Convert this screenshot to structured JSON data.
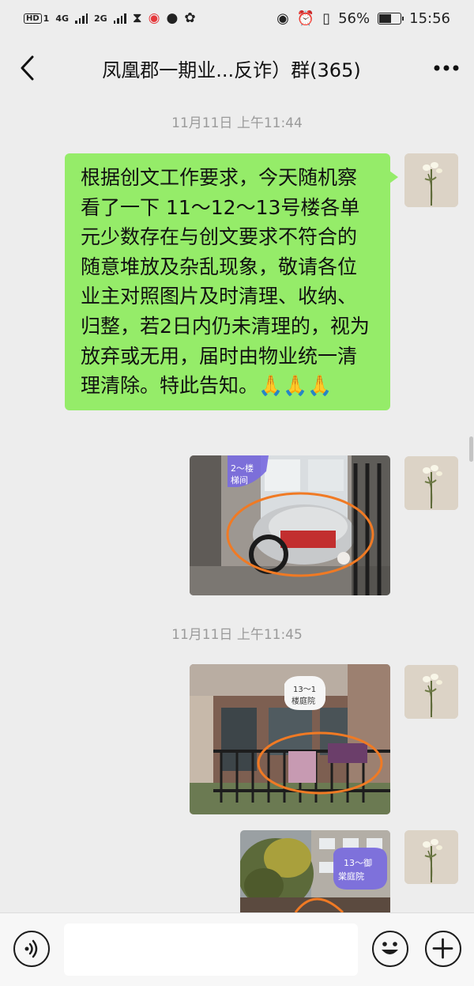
{
  "status_bar": {
    "left_hd": "HD",
    "left_sim": "1",
    "left_net1": "4G",
    "left_net2": "2G",
    "battery_percent": "56%",
    "battery_level": 0.56,
    "time": "15:56"
  },
  "header": {
    "title": "凤凰郡一期业...反诈）群(365)",
    "more_label": "···"
  },
  "messages": [
    {
      "timestamp": "11月11日 上午11:44"
    },
    {
      "type": "text",
      "text": "根据创文工作要求，今天随机察看了一下 11～12～13号楼各单元少数存在与创文要求不符合的随意堆放及杂乱现象，敬请各位业主对照图片及时清理、收纳、归整，若2日内仍未清理的，视为放弃或无用，届时由物业统一清理清除。特此告知。🙏🙏🙏"
    },
    {
      "type": "image",
      "label": "2～楼梯间"
    },
    {
      "timestamp": "11月11日 上午11:45"
    },
    {
      "type": "image",
      "label": "13～1楼庭院"
    },
    {
      "type": "image",
      "label": "13～御棠庭院"
    }
  ],
  "colors": {
    "background": "#ededed",
    "bubble": "#95ec69",
    "timestamp": "#9a9a9a"
  },
  "icons": {
    "back": "chevron-left-icon",
    "more": "more-icon",
    "voice": "voice-icon",
    "emoji": "emoji-icon",
    "plus": "plus-icon"
  }
}
